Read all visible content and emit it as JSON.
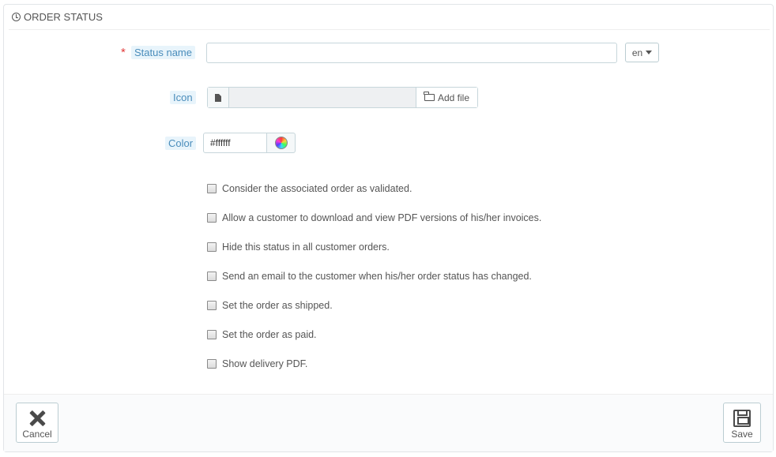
{
  "panel": {
    "title": "ORDER STATUS",
    "title_icon": "clock-icon"
  },
  "form": {
    "status_name": {
      "label": "Status name",
      "required_mark": "*",
      "value": "",
      "language": "en"
    },
    "icon": {
      "label": "Icon",
      "file_icon": "file-icon",
      "add_file_label": "Add file",
      "add_file_icon": "folder-open-icon",
      "value": ""
    },
    "color": {
      "label": "Color",
      "value": "#ffffff",
      "picker_icon": "color-wheel-icon"
    },
    "options": [
      {
        "label": "Consider the associated order as validated.",
        "checked": false
      },
      {
        "label": "Allow a customer to download and view PDF versions of his/her invoices.",
        "checked": false
      },
      {
        "label": "Hide this status in all customer orders.",
        "checked": false
      },
      {
        "label": "Send an email to the customer when his/her order status has changed.",
        "checked": false
      },
      {
        "label": "Set the order as shipped.",
        "checked": false
      },
      {
        "label": "Set the order as paid.",
        "checked": false
      },
      {
        "label": "Show delivery PDF.",
        "checked": false
      }
    ]
  },
  "footer": {
    "cancel_label": "Cancel",
    "save_label": "Save"
  },
  "colors": {
    "label_bg": "#e8f4fb",
    "label_text": "#4a8dbb",
    "required": "#e23a3a",
    "border": "#c7d6db"
  }
}
